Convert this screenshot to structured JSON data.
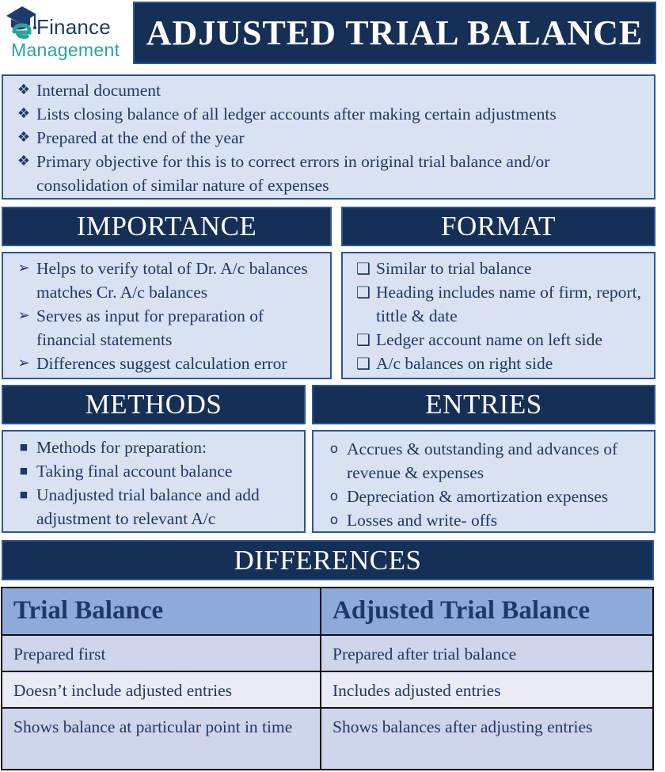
{
  "logo": {
    "line1": "Finance",
    "line2": "Management",
    "icon": "graduation-cap-icon",
    "colors": {
      "navy": "#1d3b6b",
      "teal": "#2aa39a"
    }
  },
  "title": "ADJUSTED TRIAL BALANCE",
  "colors": {
    "dark_bar": "#162f57",
    "border": "#2e5698",
    "light_box": "#d9e2f2",
    "text": "#1f3864",
    "table_header": "#8eaadb",
    "table_row_odd": "#cfd5ea",
    "table_row_even": "#e9ebf5"
  },
  "intro": {
    "bullet_icon": "diamond-bullet-icon",
    "bullet": "❖",
    "items": [
      "Internal document",
      "Lists closing balance of all ledger accounts after making certain adjustments",
      "Prepared at the end of the year",
      "Primary objective for this is to correct errors in original trial balance and/or consolidation of similar nature of expenses"
    ]
  },
  "importance": {
    "heading": "IMPORTANCE",
    "bullet_icon": "arrow-bullet-icon",
    "bullet": "➢",
    "items": [
      "Helps to verify total of Dr. A/c balances matches Cr. A/c balances",
      "Serves as input for preparation of financial statements",
      "Differences suggest calculation error"
    ]
  },
  "format": {
    "heading": "FORMAT",
    "bullet_icon": "checkbox-bullet-icon",
    "bullet": "❑",
    "items": [
      "Similar to trial balance",
      "Heading includes name of firm, report, tittle & date",
      "Ledger account name on left side",
      "A/c balances on right side"
    ]
  },
  "methods": {
    "heading": "METHODS",
    "bullet_icon": "square-bullet-icon",
    "bullet": "■",
    "items": [
      "Methods for preparation:",
      "Taking final account balance",
      "Unadjusted trial balance and add adjustment to relevant A/c"
    ]
  },
  "entries": {
    "heading": "ENTRIES",
    "bullet_icon": "circle-bullet-icon",
    "bullet": "o",
    "items": [
      "Accrues & outstanding and advances of revenue & expenses",
      "Depreciation & amortization expenses",
      "Losses and write- offs"
    ]
  },
  "differences": {
    "heading": "DIFFERENCES",
    "columns": [
      "Trial Balance",
      "Adjusted Trial Balance"
    ],
    "rows": [
      [
        "Prepared first",
        "Prepared after trial balance"
      ],
      [
        "Doesn’t include adjusted entries",
        "Includes adjusted entries"
      ],
      [
        "Shows balance at particular point in time",
        "Shows balances after adjusting entries"
      ]
    ]
  }
}
